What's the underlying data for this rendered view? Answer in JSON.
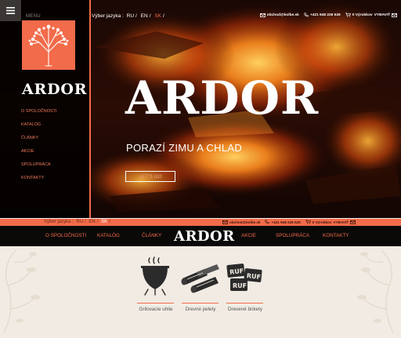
{
  "sidebar": {
    "menu_label": "MENU",
    "brand": "ARDOR",
    "nav_items": [
      "O SPOLOČNOSTI",
      "KATALÓG",
      "ČLÁNKY",
      "AKCIE",
      "SPOLUPRÁCA",
      "KONTAKTY"
    ]
  },
  "topbar": {
    "lang_label": "Výber jazyka :",
    "langs": [
      "RU",
      "EN",
      "SK"
    ],
    "current_lang": "SK",
    "email": "obchod@kolbe.sk",
    "phone": "+421 948 226 526",
    "cart": "0 Výrobkov",
    "cart_action": "VYBAVIŤ"
  },
  "hero": {
    "title": "ARDOR",
    "subtitle": "PORAZÍ ZIMU A CHLAD",
    "cta": "LET'S GO"
  },
  "main_nav": {
    "brand": "ARDOR",
    "items": [
      "O SPOLOČNOSTI",
      "KATALÓG",
      "ČLÁNKY",
      "AKCIE",
      "SPOLUPRÁCA",
      "KONTAKTY"
    ]
  },
  "categories": [
    {
      "label": "Grilovacie uhlie",
      "icon": "grill-icon"
    },
    {
      "label": "Drevné pelety",
      "icon": "wood-pellets-icon"
    },
    {
      "label": "Drevené brikety",
      "icon": "ruf-briquettes-icon"
    }
  ],
  "colors": {
    "accent": "#f26b4a",
    "dark": "#0a0908",
    "background": "#f1ebe3"
  }
}
